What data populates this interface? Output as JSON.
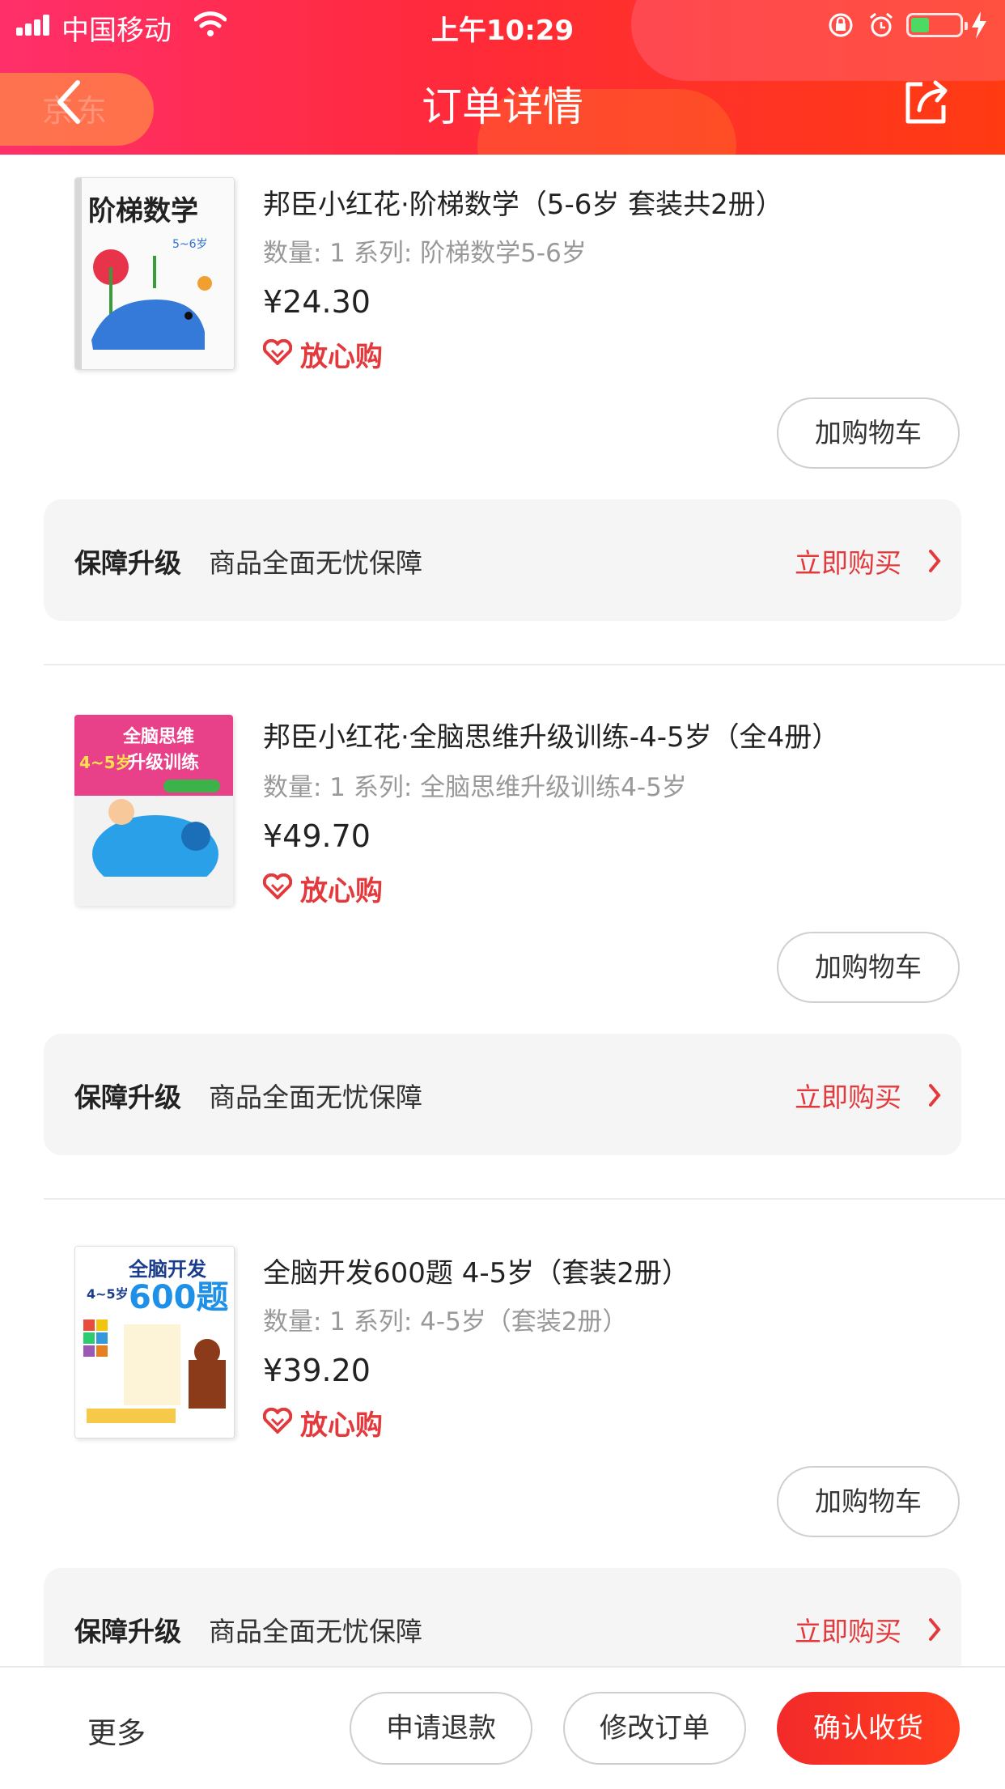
{
  "status_bar": {
    "carrier": "中国移动",
    "time": "上午10:29"
  },
  "nav": {
    "title": "订单详情",
    "back_ghost_text": "京东"
  },
  "products": [
    {
      "cover_title": "阶梯数学",
      "cover_sub": "5~6岁",
      "title": "邦臣小红花·阶梯数学（5-6岁 套装共2册）",
      "meta": "数量: 1  系列: 阶梯数学5-6岁",
      "price": "¥24.30",
      "trust_label": "放心购",
      "cart_label": "加购物车",
      "guarantee": {
        "label": "保障升级",
        "desc": "商品全面无忧保障",
        "link": "立即购买"
      }
    },
    {
      "cover_title": "全脑思维 升级训练",
      "cover_sub": "4~5岁",
      "title": "邦臣小红花·全脑思维升级训练-4-5岁（全4册）",
      "meta": "数量: 1  系列: 全脑思维升级训练4-5岁",
      "price": "¥49.70",
      "trust_label": "放心购",
      "cart_label": "加购物车",
      "guarantee": {
        "label": "保障升级",
        "desc": "商品全面无忧保障",
        "link": "立即购买"
      }
    },
    {
      "cover_title": "全脑开发 600题",
      "cover_sub": "4~5岁",
      "title": "全脑开发600题 4-5岁（套装2册）",
      "meta": "数量: 1  系列: 4-5岁（套装2册）",
      "price": "¥39.20",
      "trust_label": "放心购",
      "cart_label": "加购物车",
      "guarantee": {
        "label": "保障升级",
        "desc": "商品全面无忧保障",
        "link": "立即购买"
      }
    }
  ],
  "bottom_bar": {
    "more": "更多",
    "refund": "申请退款",
    "modify": "修改订单",
    "confirm": "确认收货"
  },
  "colors": {
    "accent_red": "#e4393c",
    "header_gradient_start": "#ff2f6a",
    "header_gradient_end": "#ff3b12"
  }
}
